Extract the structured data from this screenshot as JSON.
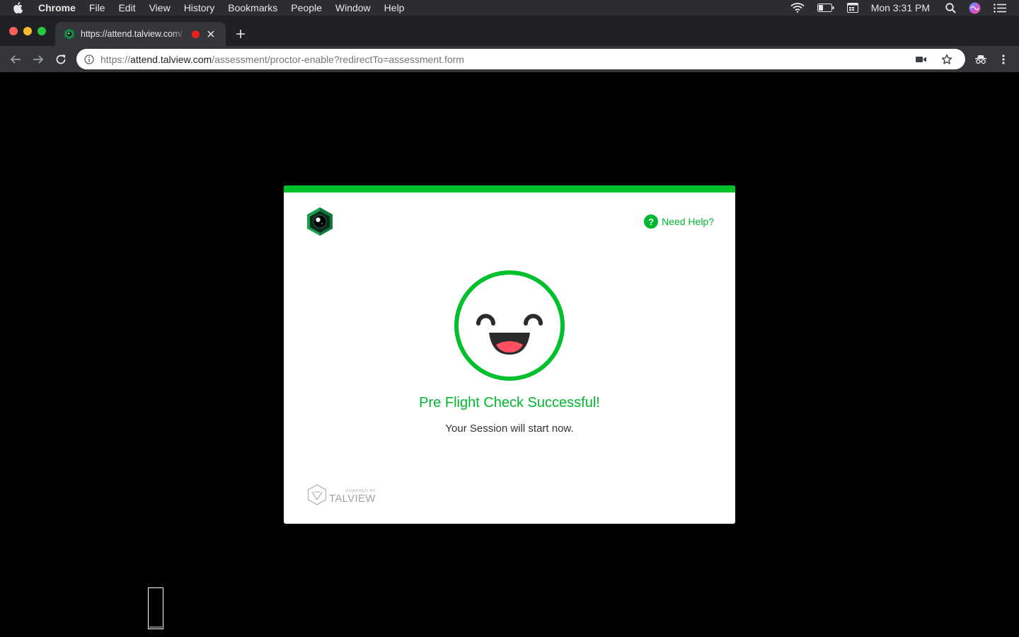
{
  "menubar": {
    "items": [
      "Chrome",
      "File",
      "Edit",
      "View",
      "History",
      "Bookmarks",
      "People",
      "Window",
      "Help"
    ],
    "clock": "Mon 3:31 PM"
  },
  "tab": {
    "title": "https://attend.talview.com/",
    "favicon": "talview-icon"
  },
  "address": {
    "scheme": "https://",
    "host": "attend.talview.com",
    "path": "/assessment/proctor-enable?redirectTo=assessment.form"
  },
  "card": {
    "accent": "#00c02c",
    "help_label": "Need Help?",
    "help_icon": "?",
    "title": "Pre Flight Check Successful!",
    "subtitle": "Your Session will start now.",
    "powered_by": "POWERED BY",
    "brand": "TALVIEW"
  }
}
